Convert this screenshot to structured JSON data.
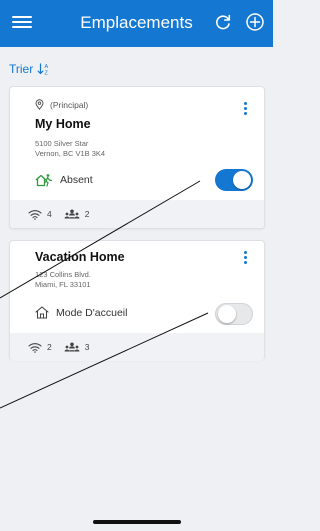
{
  "header": {
    "title": "Emplacements",
    "menu_icon": "menu-icon",
    "refresh_icon": "refresh-icon",
    "add_icon": "add-circle-icon",
    "background": "#1478d2"
  },
  "sort": {
    "label": "Trier",
    "icon": "sort-icon"
  },
  "locations": [
    {
      "tag": "(Principal)",
      "name": "My Home",
      "address_line1": "5100 Silver Star",
      "address_line2": "Vernon, BC V1B 3K4",
      "mode_label": "Absent",
      "mode_icon": "away-icon",
      "toggle_on": true,
      "wifi_count": "4",
      "users_count": "2"
    },
    {
      "name": "Vacation Home",
      "address_line1": "123 Collins Blvd.",
      "address_line2": "Miami, FL 33101",
      "mode_label": "Mode D'accueil",
      "mode_icon": "home-icon",
      "toggle_on": false,
      "wifi_count": "2",
      "users_count": "3"
    }
  ],
  "colors": {
    "accent": "#1478d2",
    "away_green": "#2e9b3e"
  }
}
